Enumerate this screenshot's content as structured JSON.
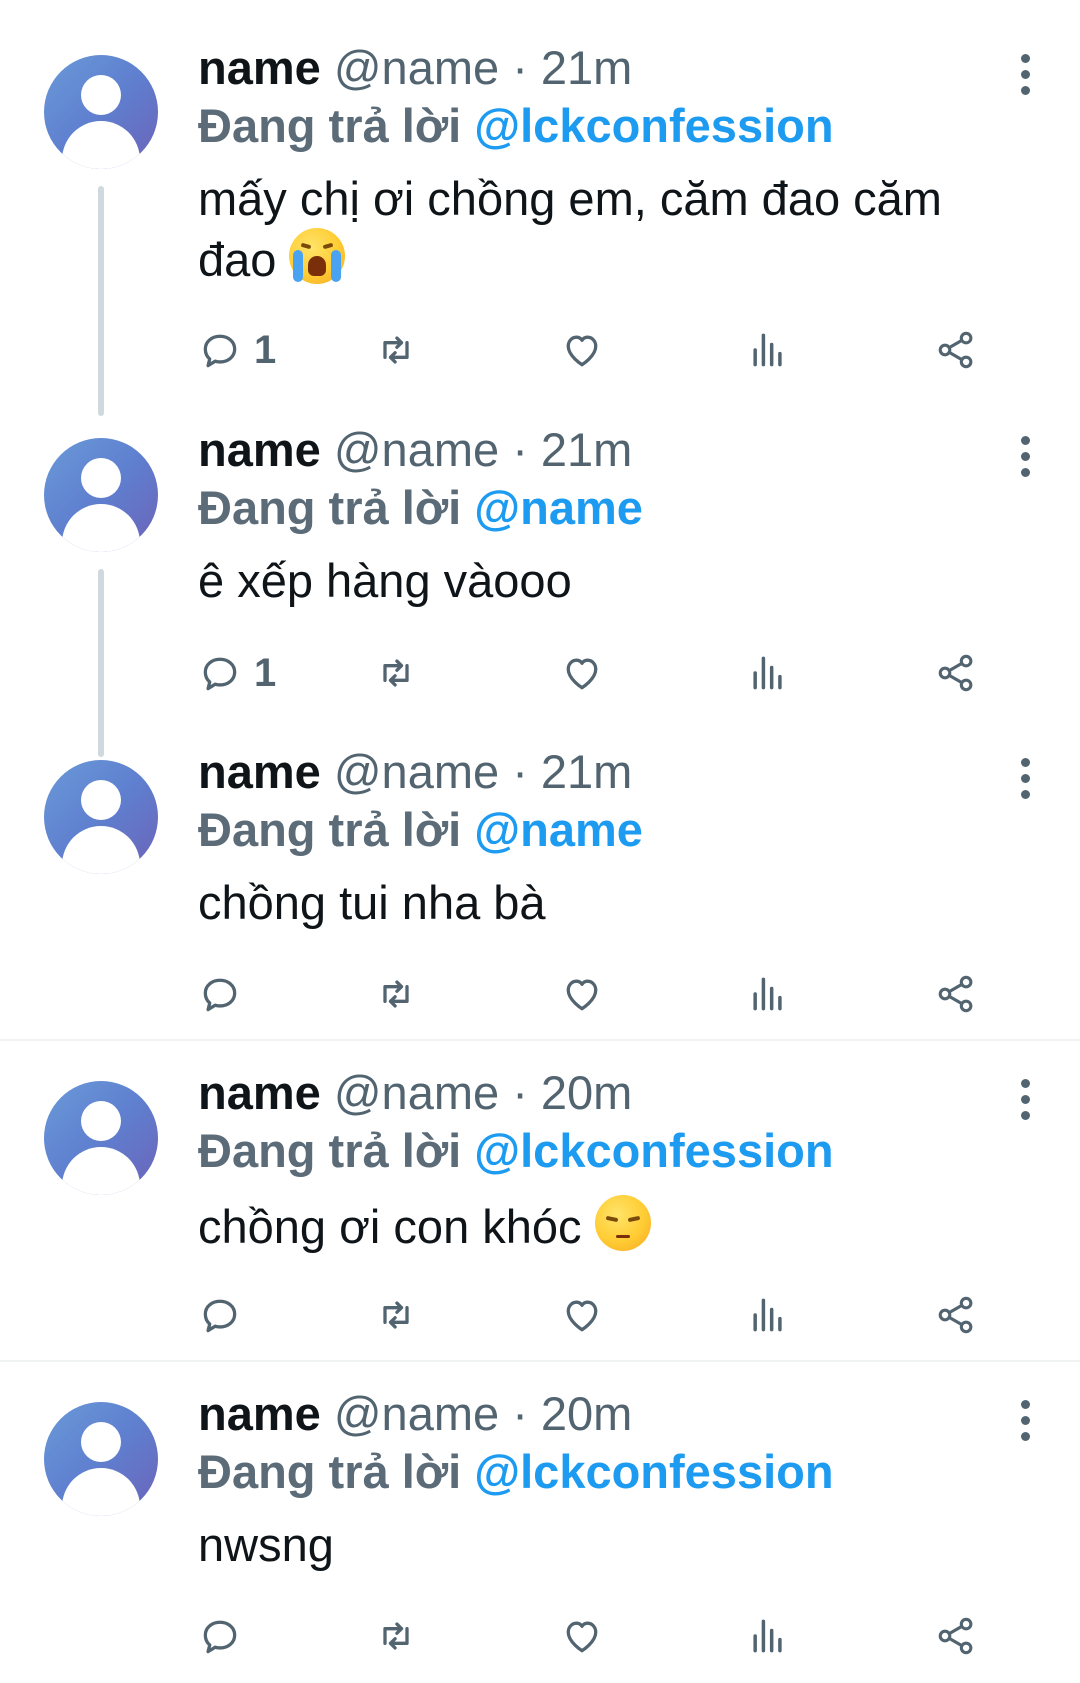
{
  "tweets": [
    {
      "name": "name",
      "handle": "@name",
      "separator": "·",
      "time": "21m",
      "replying_prefix": "Đang trả lời",
      "replying_to": "@lckconfession",
      "text_line1": "mấy chị ơi chồng em, căm đao căm",
      "text_line2": "đao",
      "emoji": "loudly-crying-face",
      "reply_count": "1"
    },
    {
      "name": "name",
      "handle": "@name",
      "separator": "·",
      "time": "21m",
      "replying_prefix": "Đang trả lời",
      "replying_to": "@name",
      "text": "ê xếp hàng vàooo",
      "reply_count": "1"
    },
    {
      "name": "name",
      "handle": "@name",
      "separator": "·",
      "time": "21m",
      "replying_prefix": "Đang trả lời",
      "replying_to": "@name",
      "text": "chồng tui nha bà",
      "reply_count": ""
    },
    {
      "name": "name",
      "handle": "@name",
      "separator": "·",
      "time": "20m",
      "replying_prefix": "Đang trả lời",
      "replying_to": "@lckconfession",
      "text": "chồng ơi con khóc",
      "emoji": "pensive-face",
      "reply_count": ""
    },
    {
      "name": "name",
      "handle": "@name",
      "separator": "·",
      "time": "20m",
      "replying_prefix": "Đang trả lời",
      "replying_to": "@lckconfession",
      "text": "nwsng",
      "reply_count": ""
    }
  ],
  "icons": {
    "reply": "reply-icon",
    "retweet": "retweet-icon",
    "like": "heart-icon",
    "views": "analytics-icon",
    "share": "share-icon",
    "more": "more-options-icon"
  },
  "colors": {
    "accent": "#1d9bf0",
    "secondary_text": "#536471",
    "primary_text": "#0f1419",
    "thread_line": "#cfd9de",
    "divider": "#eff3f4"
  }
}
